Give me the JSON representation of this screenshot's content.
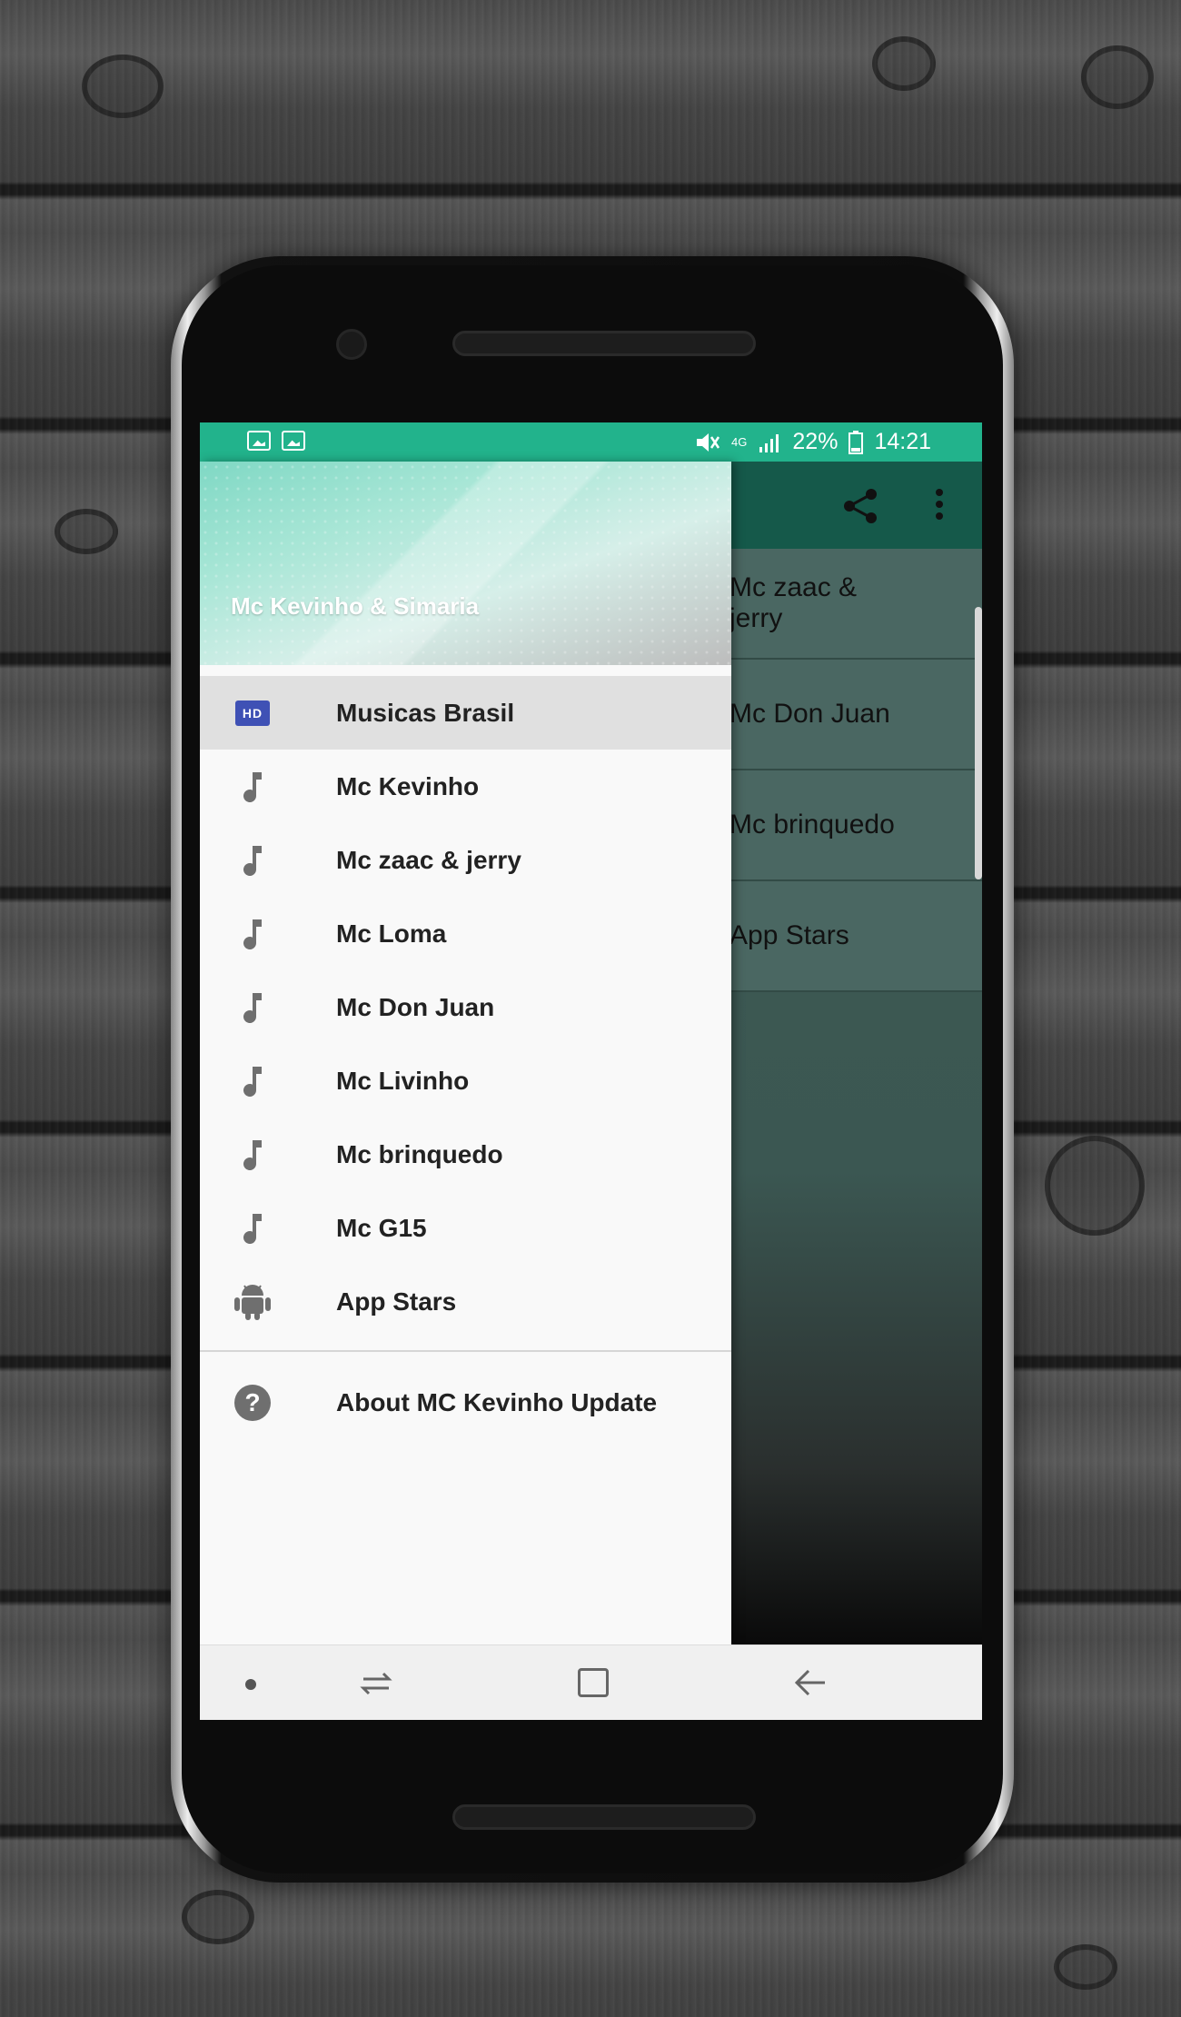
{
  "status_bar": {
    "network": "4G",
    "battery": "22%",
    "time": "14:21"
  },
  "drawer": {
    "title": "Mc Kevinho & Simaria",
    "items": [
      {
        "label": "Musicas Brasil",
        "icon": "hd-icon",
        "selected": true
      },
      {
        "label": "Mc Kevinho",
        "icon": "music-note-icon"
      },
      {
        "label": "Mc zaac & jerry",
        "icon": "music-note-icon"
      },
      {
        "label": "Mc Loma",
        "icon": "music-note-icon"
      },
      {
        "label": "Mc Don Juan",
        "icon": "music-note-icon"
      },
      {
        "label": "Mc Livinho",
        "icon": "music-note-icon"
      },
      {
        "label": "Mc brinquedo",
        "icon": "music-note-icon"
      },
      {
        "label": "Mc G15",
        "icon": "music-note-icon"
      },
      {
        "label": "App Stars",
        "icon": "android-icon"
      }
    ],
    "about": {
      "label": "About MC Kevinho Update",
      "icon": "help-icon"
    }
  },
  "background_list": {
    "items": [
      "Mc zaac & jerry",
      "Mc Don Juan",
      "Mc brinquedo",
      "App Stars"
    ]
  },
  "hd_badge": "HD",
  "help_glyph": "?",
  "colors": {
    "status_bar": "#22b38c",
    "toolbar": "#15594a",
    "hd_icon": "#3f51b5"
  }
}
